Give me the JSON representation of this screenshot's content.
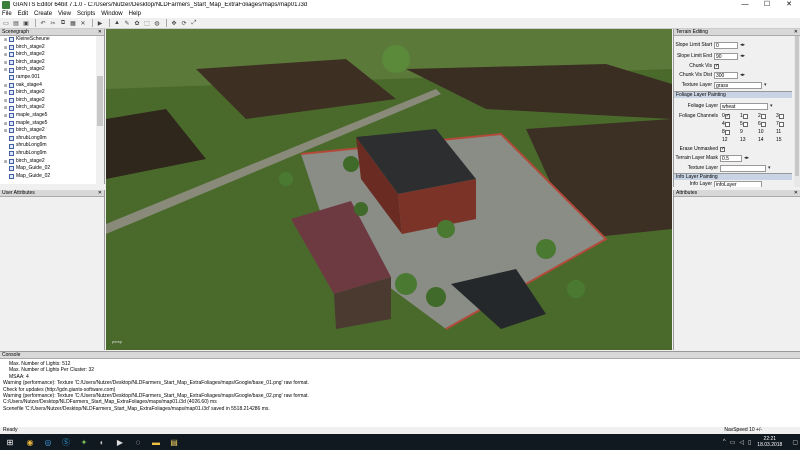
{
  "window": {
    "title": "GIANTS Editor 64bit 7.1.0 - C:/Users/Nutzer/Desktop/NLDFarmers_Start_Map_ExtraFoliages/maps/map01.i3d",
    "minimize": "—",
    "maximize": "☐",
    "close": "✕"
  },
  "menu": [
    "File",
    "Edit",
    "Create",
    "View",
    "Scripts",
    "Window",
    "Help"
  ],
  "scenegraph": {
    "title": "Scenegraph",
    "close": "✕",
    "items": [
      "KleineScheune",
      "birch_stage2",
      "birch_stage2",
      "birch_stage2",
      "birch_stage2",
      "rampe.001",
      "oak_stage4",
      "birch_stage2",
      "birch_stage2",
      "birch_stage2",
      "maple_stage5",
      "maple_stage5",
      "birch_stage2",
      "shrubLong9m",
      "shrubLong9m",
      "shrubLong9m",
      "birch_stage2",
      "Map_Guide_02",
      "Map_Guide_02"
    ]
  },
  "user_attributes": {
    "title": "User Attributes",
    "close": "✕"
  },
  "viewport": {
    "camera_label": "persp"
  },
  "terrain": {
    "title": "Terrain Editing",
    "close": "✕",
    "slope_limit_start": {
      "label": "Slope Limit Start",
      "value": "0"
    },
    "slope_limit_end": {
      "label": "Slope Limit End",
      "value": "90"
    },
    "chunk_vis": {
      "label": "Chunk Vis"
    },
    "chunk_vis_dist": {
      "label": "Chunk Vis Dist",
      "value": "300"
    },
    "texture_layer": {
      "label": "Texture Layer",
      "value": "grass"
    },
    "foliage_section": "Foliage Layer Painting",
    "foliage_layer": {
      "label": "Foliage Layer",
      "value": "wheat"
    },
    "foliage_channels": {
      "label": "Foliage Channels",
      "numbers": [
        "0",
        "1",
        "2",
        "3",
        "4",
        "5",
        "6",
        "7",
        "8",
        "9",
        "10",
        "11",
        "12",
        "13",
        "14",
        "15"
      ]
    },
    "erase_unmasked": {
      "label": "Erase Unmasked"
    },
    "terrain_layer_mask": {
      "label": "Terrain Layer Mask",
      "value": "0.5"
    },
    "texture_layer2": {
      "label": "Texture Layer"
    },
    "info_section": "Info Layer Painting",
    "info_layer": {
      "label": "Info Layer",
      "value": "infoLayer"
    },
    "arrows": "◂▸"
  },
  "attributes": {
    "title": "Attributes",
    "close": "✕"
  },
  "console": {
    "title": "Console",
    "lines": [
      "Max. Number of Lights: 512",
      "Max. Number of Lights Per Cluster: 32",
      "MSAA: 4",
      "Warning (performance): Texture 'C:/Users/Nutzer/Desktop/NLDFarmers_Start_Map_ExtraFoliages/maps/Google/base_01.png' raw format.",
      "Check for updates (http://gdn.giants-software.com)",
      "Warning (performance): Texture 'C:/Users/Nutzer/Desktop/NLDFarmers_Start_Map_ExtraFoliages/maps/Google/base_02.png' raw format.",
      "C:/Users/Nutzer/Desktop/NLDFarmers_Start_Map_ExtraFoliages/maps/map01.i3d (4026.60) ms",
      "Scenefile 'C:/Users/Nutzer/Desktop/NLDFarmers_Start_Map_ExtraFoliages/maps/map01.i3d' saved in 5518.214286 ms."
    ]
  },
  "status": {
    "left": "Ready",
    "nav_speed": "NavSpeed 10 +/-"
  },
  "taskbar": {
    "time": "22:21",
    "date": "18.03.2018",
    "apps": [
      "windows-icon",
      "chrome-icon",
      "browser-icon",
      "skype-icon",
      "game-icon",
      "steam-icon",
      "media-icon",
      "giants-icon",
      "folder-icon",
      "notes-icon"
    ]
  }
}
